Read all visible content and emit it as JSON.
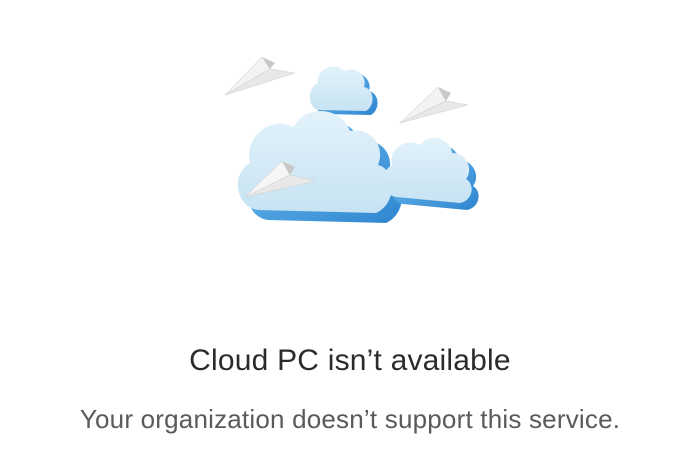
{
  "message": {
    "title": "Cloud PC isn’t available",
    "subtitle": "Your organization doesn’t support this service."
  },
  "illustration": {
    "icon": "clouds-paper-planes-icon",
    "colors": {
      "cloud_face": "#d3eaf7",
      "cloud_side": "#4aa3e6",
      "cloud_side_dark": "#2f86d0",
      "plane_light": "#f4f4f4",
      "plane_shadow": "#c9c9c9"
    }
  }
}
